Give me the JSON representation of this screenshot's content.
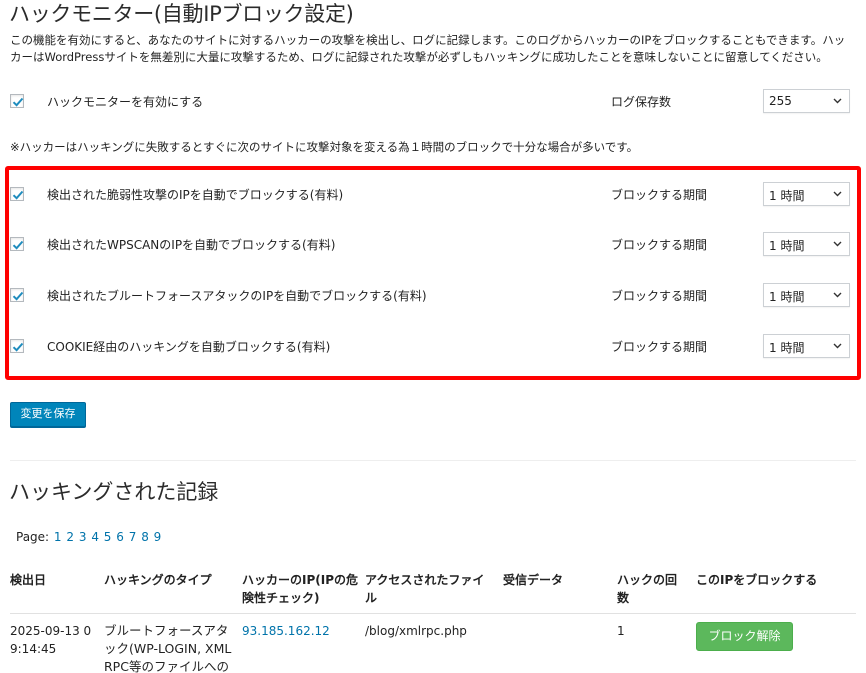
{
  "page_title": "ハックモニター(自動IPブロック設定)",
  "description": "この機能を有効にすると、あなたのサイトに対するハッカーの攻撃を検出し、ログに記録します。このログからハッカーのIPをブロックすることもできます。ハッカーはWordPressサイトを無差別に大量に攻撃するため、ログに記録された攻撃が必ずしもハッキングに成功したことを意味しないことに留意してください。",
  "enable_row": {
    "label": "ハックモニターを有効にする",
    "checked": true,
    "log_label": "ログ保存数",
    "log_value": "255"
  },
  "note": "※ハッカーはハッキングに失敗するとすぐに次のサイトに攻撃対象を変える為１時間のブロックで十分な場合が多いです。",
  "auto_block_rows": [
    {
      "label": "検出された脆弱性攻撃のIPを自動でブロックする(有料)",
      "checked": true,
      "period_label": "ブロックする期間",
      "period_value": "1 時間"
    },
    {
      "label": "検出されたWPSCANのIPを自動でブロックする(有料)",
      "checked": true,
      "period_label": "ブロックする期間",
      "period_value": "1 時間"
    },
    {
      "label": "検出されたブルートフォースアタックのIPを自動でブロックする(有料)",
      "checked": true,
      "period_label": "ブロックする期間",
      "period_value": "1 時間"
    },
    {
      "label": "COOKIE経由のハッキングを自動ブロックする(有料)",
      "checked": true,
      "period_label": "ブロックする期間",
      "period_value": "1 時間"
    }
  ],
  "save_button": "変更を保存",
  "records_title": "ハッキングされた記録",
  "pager": {
    "label": "Page:",
    "pages": [
      "1",
      "2",
      "3",
      "4",
      "5",
      "6",
      "7",
      "8",
      "9"
    ]
  },
  "table": {
    "headers": {
      "date": "検出日",
      "type": "ハッキングのタイプ",
      "ip_1": "ハッカーのIP(IPの危",
      "ip_2": "険性チェック)",
      "file_1": "アクセスされたファイ",
      "file_2": "ル",
      "data": "受信データ",
      "count_1": "ハックの回",
      "count_2": "数",
      "block": "このIPをブロックする"
    },
    "rows": [
      {
        "date_1": "2025-09-13 0",
        "date_2": "9:14:45",
        "type_1": "ブルートフォースアタ",
        "type_2": "ック(WP-LOGIN, XML",
        "type_3": "RPC等のファイルへの",
        "ip": "93.185.162.12",
        "file": "/blog/xmlrpc.php",
        "data": "",
        "count": "1",
        "action": "ブロック解除"
      }
    ]
  },
  "colors": {
    "highlight": "#ff0000",
    "primary_button": "#0085ba",
    "unblock_button": "#5cb85c",
    "link": "#0073aa"
  }
}
